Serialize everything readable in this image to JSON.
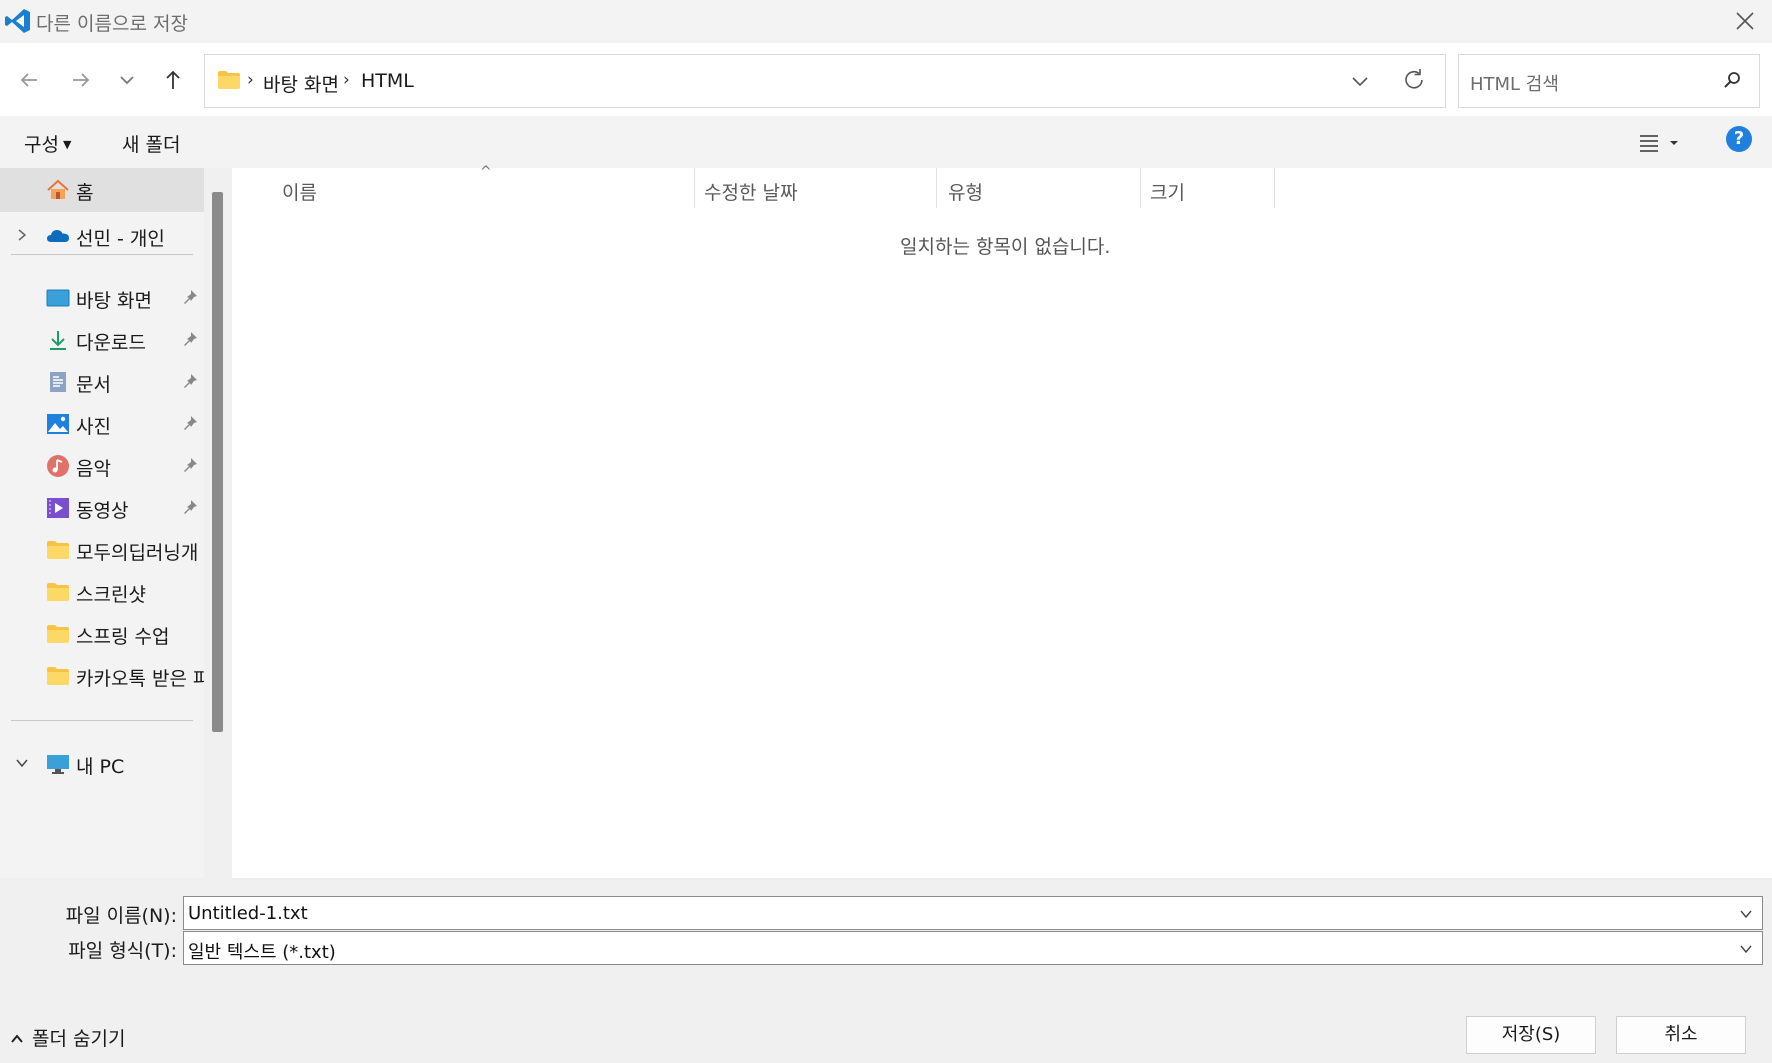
{
  "window": {
    "title": "다른 이름으로 저장",
    "app_icon": "vscode-icon",
    "close_icon": "close-icon"
  },
  "navigation": {
    "back_icon": "arrow-left-icon",
    "forward_icon": "arrow-right-icon",
    "recent_icon": "chevron-down-icon",
    "up_icon": "arrow-up-icon",
    "breadcrumb": [
      "바탕 화면",
      "HTML"
    ],
    "refresh_icon": "refresh-icon",
    "search_placeholder": "HTML 검색"
  },
  "toolbar": {
    "organize_label": "구성",
    "new_folder_label": "새 폴더",
    "view_icon": "list-view-icon",
    "help_label": "?"
  },
  "sidebar": {
    "items": [
      {
        "label": "홈",
        "icon": "home-icon"
      },
      {
        "label": "선민 - 개인",
        "icon": "onedrive-cloud-icon"
      },
      {
        "label": "바탕 화면",
        "icon": "desktop-icon",
        "pinned": true
      },
      {
        "label": "다운로드",
        "icon": "download-icon",
        "pinned": true
      },
      {
        "label": "문서",
        "icon": "document-icon",
        "pinned": true
      },
      {
        "label": "사진",
        "icon": "pictures-icon",
        "pinned": true
      },
      {
        "label": "음악",
        "icon": "music-icon",
        "pinned": true
      },
      {
        "label": "동영상",
        "icon": "video-icon",
        "pinned": true
      },
      {
        "label": "모두의딥러닝개",
        "icon": "folder-icon"
      },
      {
        "label": "스크린샷",
        "icon": "folder-icon"
      },
      {
        "label": "스프링 수업",
        "icon": "folder-icon"
      },
      {
        "label": "카카오톡 받은 파",
        "icon": "folder-icon"
      },
      {
        "label": "내 PC",
        "icon": "pc-icon"
      }
    ]
  },
  "file_list": {
    "columns": [
      "이름",
      "수정한 날짜",
      "유형",
      "크기"
    ],
    "empty_message": "일치하는 항목이 없습니다."
  },
  "form": {
    "filename_label": "파일 이름(N):",
    "filename_value": "Untitled-1.txt",
    "filetype_label": "파일 형식(T):",
    "filetype_value": "일반 텍스트 (*.txt)"
  },
  "footer": {
    "hide_folders_label": "폴더 숨기기",
    "save_label": "저장(S)",
    "cancel_label": "취소"
  },
  "colors": {
    "accent": "#1f80e0",
    "folder": "#f6c344"
  }
}
